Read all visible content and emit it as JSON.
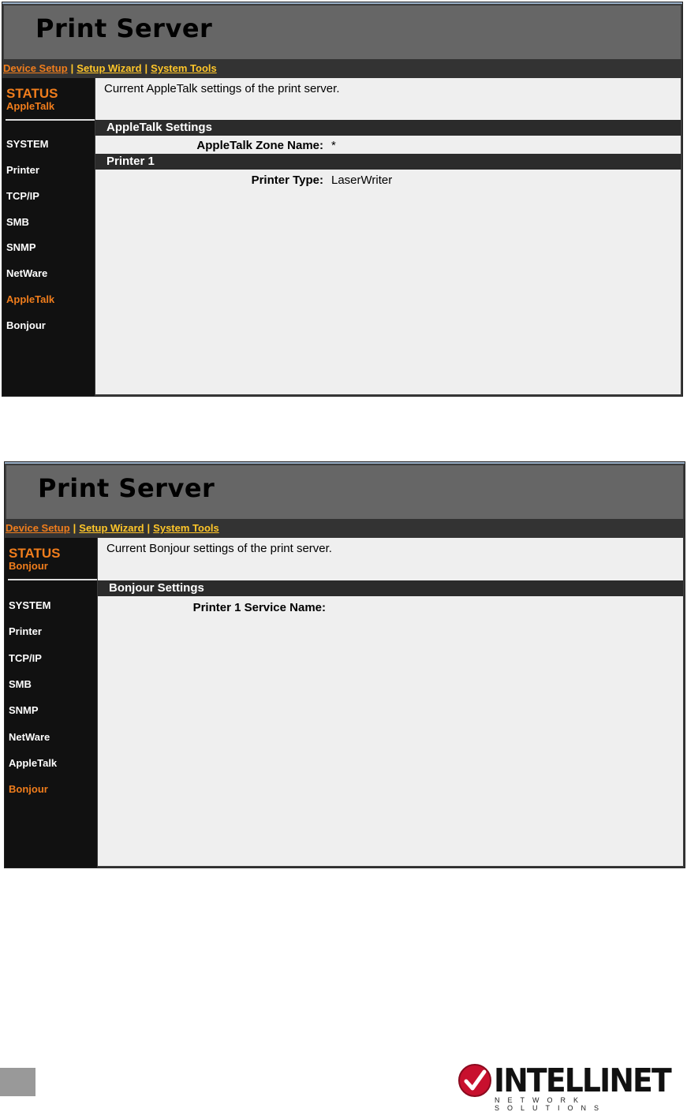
{
  "colors": {
    "accent_orange": "#f07d1c",
    "nav_yellow": "#ffc629",
    "header_gray": "#666666",
    "sidebar_black": "#111111",
    "content_gray": "#efefef",
    "section_bar": "#2b2b2b"
  },
  "nav": {
    "device_setup": "Device Setup",
    "separator": "|",
    "setup_wizard": "Setup Wizard",
    "system_tools": "System Tools"
  },
  "sidebar_items": [
    "SYSTEM",
    "Printer",
    "TCP/IP",
    "SMB",
    "SNMP",
    "NetWare",
    "AppleTalk",
    "Bonjour"
  ],
  "panel1": {
    "title": "Print Server",
    "status_title": "STATUS",
    "status_sub": "AppleTalk",
    "active_item": "AppleTalk",
    "description": "Current AppleTalk settings of the print server.",
    "section1": "AppleTalk Settings",
    "zone_label": "AppleTalk Zone Name:",
    "zone_value": "*",
    "section2": "Printer 1",
    "printer_type_label": "Printer Type:",
    "printer_type_value": "LaserWriter"
  },
  "panel2": {
    "title": "Print Server",
    "status_title": "STATUS",
    "status_sub": "Bonjour",
    "active_item": "Bonjour",
    "description": "Current Bonjour settings of the print server.",
    "section1": "Bonjour Settings",
    "service_label": "Printer 1 Service Name:",
    "service_value": ""
  },
  "footer": {
    "logo_word": "INTELLINET",
    "logo_tag": "NETWORK SOLUTIONS",
    "logo_icon": "checkmark-circle-icon"
  }
}
